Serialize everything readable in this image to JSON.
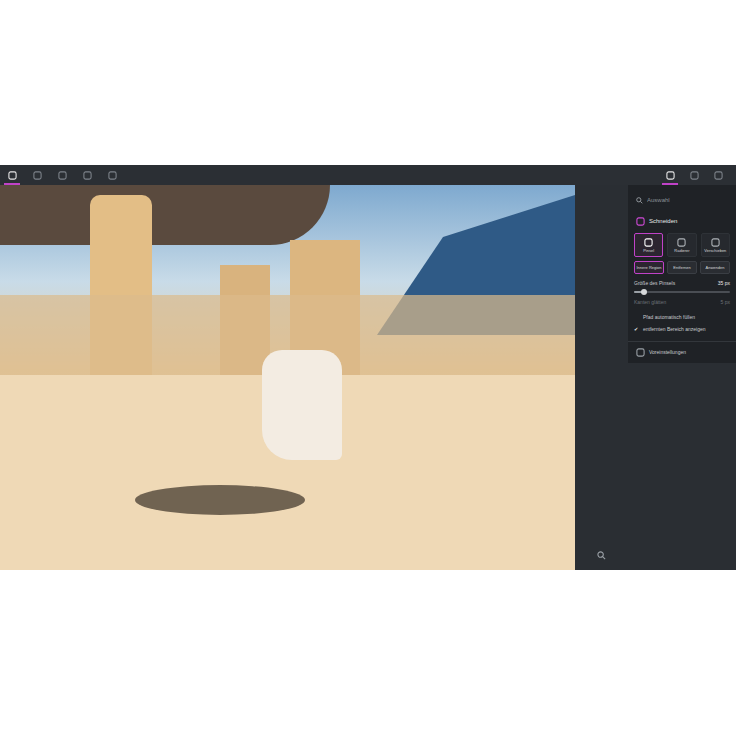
{
  "toolbar": {
    "left_tools": [
      {
        "selected": true
      },
      {
        "selected": false
      },
      {
        "selected": false
      },
      {
        "selected": false
      },
      {
        "selected": false
      }
    ],
    "right_tools": [
      {
        "selected": true
      },
      {
        "selected": false
      },
      {
        "selected": false
      }
    ]
  },
  "panel": {
    "search": {
      "placeholder": "Auswahl"
    },
    "section": {
      "title": "Schneiden"
    },
    "tools": [
      {
        "label": "Pinsel",
        "selected": true
      },
      {
        "label": "Radierer",
        "selected": false
      },
      {
        "label": "Verschieben",
        "selected": false
      }
    ],
    "actions": [
      {
        "label": "Innere Region",
        "selected": true
      },
      {
        "label": "Entfernen",
        "selected": false
      },
      {
        "label": "Anwenden",
        "selected": false
      }
    ],
    "brush_size": {
      "label": "Größe des Pinsels",
      "reading": "35 px",
      "level": 0.1
    },
    "smoothing": {
      "label": "Kanten glätten",
      "reading": "5 px",
      "disabled": true
    },
    "checkboxes": [
      {
        "label": "Pfad automatisch füllen",
        "checked": false
      },
      {
        "label": "entfernten Bereich anzeigen",
        "checked": true
      }
    ],
    "footer": {
      "label": "Voreinstellungen"
    }
  }
}
